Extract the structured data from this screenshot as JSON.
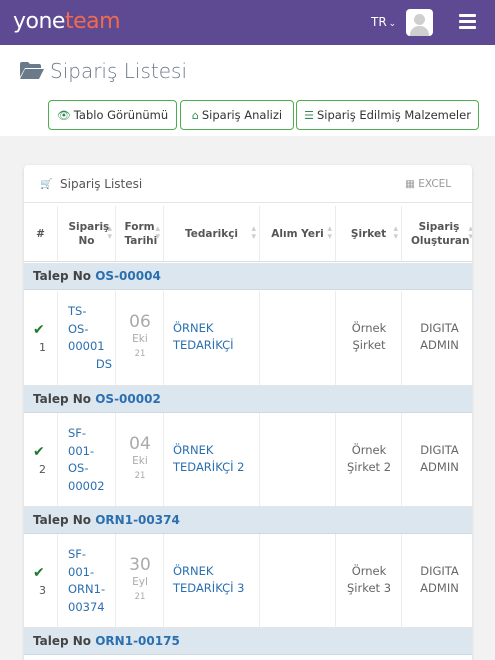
{
  "app": {
    "logo_part1": "yone",
    "logo_part2": "team",
    "lang": "TR"
  },
  "colors": {
    "header_bg": "#5e4a93",
    "accent": "#f26a4b",
    "link": "#2a6fb0",
    "button_border": "#4cae4c"
  },
  "page": {
    "title": "Sipariş Listesi"
  },
  "buttons": {
    "table_view": "Tablo Görünümü",
    "analysis": "Sipariş Analizi",
    "ordered_materials": "Sipariş Edilmiş Malzemeler"
  },
  "panel": {
    "title": "Sipariş Listesi",
    "excel": "EXCEL"
  },
  "table": {
    "headers": {
      "num": "#",
      "order_no": "Sipariş No",
      "form_date": "Form Tarihi",
      "supplier": "Tedarikçi",
      "buy_place": "Alım Yeri",
      "company": "Şirket",
      "created_by": "Sipariş Oluşturan"
    },
    "groups": [
      {
        "label": "Talep No",
        "code": "OS-00004"
      },
      {
        "label": "Talep No",
        "code": "OS-00002"
      },
      {
        "label": "Talep No",
        "code": "ORN1-00374"
      },
      {
        "label": "Talep No",
        "code": "ORN1-00175"
      }
    ],
    "rows": [
      {
        "index": "1",
        "order_lines": [
          "TS-",
          "OS-",
          "00001"
        ],
        "order_suffix": "DS",
        "day": "06",
        "month": "Eki",
        "year": "21",
        "supplier_lines": [
          "ÖRNEK",
          "TEDARİKÇİ"
        ],
        "company_lines": [
          "Örnek",
          "Şirket"
        ],
        "creator_lines": [
          "DIGITA",
          "ADMIN"
        ]
      },
      {
        "index": "2",
        "order_lines": [
          "SF-",
          "001-",
          "OS-",
          "00002"
        ],
        "order_suffix": "",
        "day": "04",
        "month": "Eki",
        "year": "21",
        "supplier_lines": [
          "ÖRNEK",
          "TEDARİKÇİ 2"
        ],
        "company_lines": [
          "Örnek",
          "Şirket 2"
        ],
        "creator_lines": [
          "DIGITA",
          "ADMIN"
        ]
      },
      {
        "index": "3",
        "order_lines": [
          "SF-",
          "001-",
          "ORN1-",
          "00374"
        ],
        "order_suffix": "",
        "day": "30",
        "month": "Eyl",
        "year": "21",
        "supplier_lines": [
          "ÖRNEK",
          "TEDARİKÇİ 3"
        ],
        "company_lines": [
          "Örnek",
          "Şirket 3"
        ],
        "creator_lines": [
          "DIGITA",
          "ADMIN"
        ]
      }
    ]
  }
}
